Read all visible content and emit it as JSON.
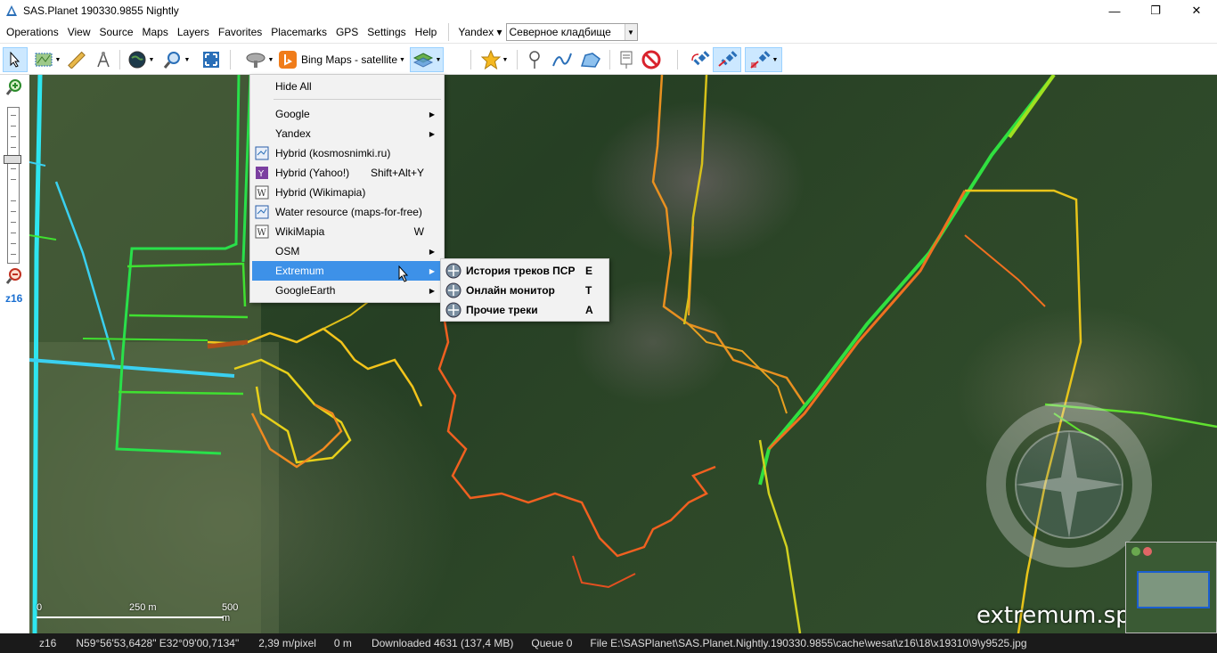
{
  "window": {
    "title": "SAS.Planet 190330.9855 Nightly",
    "min": "—",
    "max": "❐",
    "close": "✕"
  },
  "menubar": {
    "items": [
      "Operations",
      "View",
      "Source",
      "Maps",
      "Layers",
      "Favorites",
      "Placemarks",
      "GPS",
      "Settings",
      "Help"
    ],
    "geocoder_label": "Yandex ▾",
    "search_value": "Северное кладбище"
  },
  "toolbar": {
    "map_source_label": "Bing Maps - satellite"
  },
  "left_panel": {
    "zoom_level": "z16"
  },
  "layers_menu": {
    "items": [
      {
        "label": "Hide All",
        "shortcut": "",
        "submenu": false,
        "icon": "none"
      },
      {
        "label": "Google",
        "shortcut": "",
        "submenu": true,
        "icon": "none"
      },
      {
        "label": "Yandex",
        "shortcut": "",
        "submenu": true,
        "icon": "none"
      },
      {
        "label": "Hybrid (kosmosnimki.ru)",
        "shortcut": "",
        "submenu": false,
        "icon": "map-icon"
      },
      {
        "label": "Hybrid (Yahoo!)",
        "shortcut": "Shift+Alt+Y",
        "submenu": false,
        "icon": "yahoo-icon"
      },
      {
        "label": "Hybrid (Wikimapia)",
        "shortcut": "",
        "submenu": false,
        "icon": "wiki-icon"
      },
      {
        "label": "Water resource (maps-for-free)",
        "shortcut": "",
        "submenu": false,
        "icon": "map-icon"
      },
      {
        "label": "WikiMapia",
        "shortcut": "W",
        "submenu": false,
        "icon": "wiki-icon"
      },
      {
        "label": "OSM",
        "shortcut": "",
        "submenu": true,
        "icon": "none"
      },
      {
        "label": "Extremum",
        "shortcut": "",
        "submenu": true,
        "icon": "none"
      },
      {
        "label": "GoogleEarth",
        "shortcut": "",
        "submenu": true,
        "icon": "none"
      }
    ]
  },
  "extremum_submenu": {
    "items": [
      {
        "label": "История треков ПСР",
        "shortcut": "E"
      },
      {
        "label": "Онлайн монитор",
        "shortcut": "T"
      },
      {
        "label": "Прочие треки",
        "shortcut": "A"
      }
    ]
  },
  "map": {
    "scale_labels": [
      "0",
      "250 m",
      "500 m"
    ],
    "watermark": "extremum.spb.ru"
  },
  "statusbar": {
    "zoom": "z16",
    "coords": "N59°56'53,6428\" E32°09'00,7134\"",
    "resolution": "2,39 m/pixel",
    "distance": "0 m",
    "downloaded": "Downloaded 4631 (137,4 MB)",
    "queue": "Queue 0",
    "file": "File E:\\SASPlanet\\SAS.Planet.Nightly.190330.9855\\cache\\wesat\\z16\\18\\x19310\\9\\y9525.jpg"
  },
  "colors": {
    "menu_highlight": "#3d91e8",
    "pressed_button": "#cce8ff",
    "zoom_label": "#1a6fd1"
  }
}
